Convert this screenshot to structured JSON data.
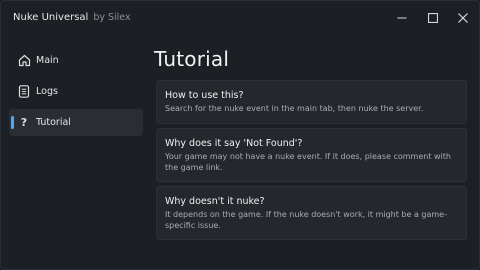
{
  "window": {
    "title": "Nuke Universal",
    "subtitle": "by Silex",
    "controls": [
      "minimize-icon",
      "maximize-icon",
      "close-icon"
    ]
  },
  "sidebar": {
    "items": [
      {
        "label": "Main",
        "icon": "home-icon",
        "active": false
      },
      {
        "label": "Logs",
        "icon": "document-icon",
        "active": false
      },
      {
        "label": "Tutorial",
        "icon": "question-icon",
        "glyph": "?",
        "active": true
      }
    ]
  },
  "main": {
    "title": "Tutorial",
    "cards": [
      {
        "question": "How to use this?",
        "answer": "Search for the nuke event in the main tab, then nuke the server."
      },
      {
        "question": "Why does it say 'Not Found'?",
        "answer": "Your game may not have a nuke event. If it does, please comment with the game link."
      },
      {
        "question": "Why doesn't it nuke?",
        "answer": "It depends on the game. If the nuke doesn't work, it might be a game-specific issue."
      }
    ]
  },
  "colors": {
    "background": "#1c2024",
    "card": "#24282d",
    "accent": "#5aa7e6",
    "text": "#eef0f2",
    "muted": "#a9adb2"
  }
}
